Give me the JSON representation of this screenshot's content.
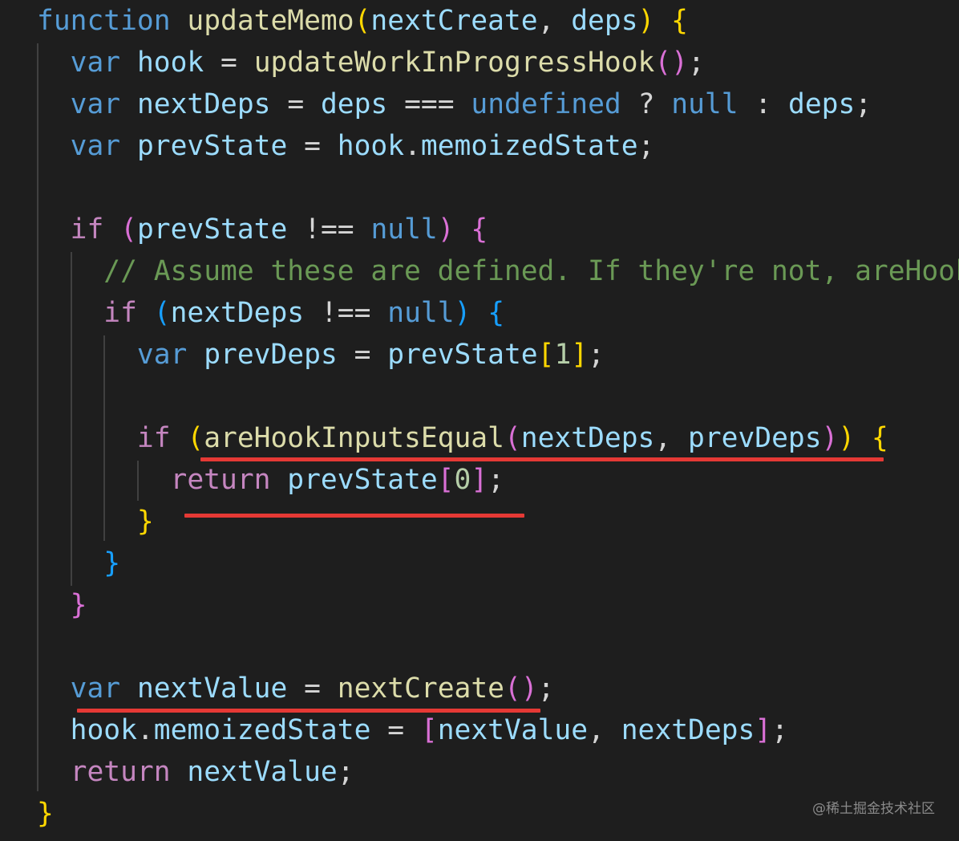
{
  "editor": {
    "language": "javascript",
    "lines": [
      "function updateMemo(nextCreate, deps) {",
      "  var hook = updateWorkInProgressHook();",
      "  var nextDeps = deps === undefined ? null : deps;",
      "  var prevState = hook.memoizedState;",
      "",
      "  if (prevState !== null) {",
      "    // Assume these are defined. If they're not, areHookInputsEqual will warn.",
      "    if (nextDeps !== null) {",
      "      var prevDeps = prevState[1];",
      "",
      "      if (areHookInputsEqual(nextDeps, prevDeps)) {",
      "        return prevState[0];",
      "      }",
      "    }",
      "  }",
      "",
      "  var nextValue = nextCreate();",
      "  hook.memoizedState = [nextValue, nextDeps];",
      "  return nextValue;",
      "}"
    ]
  },
  "colors": {
    "background": "#1e1e1e",
    "storage_keyword": "#569cd6",
    "control_keyword": "#c586c0",
    "function_name": "#dcdcaa",
    "variable": "#9cdcfe",
    "comment": "#6a9955",
    "number": "#b5cea8",
    "bracket_level_1": "#ffd700",
    "bracket_level_2": "#da70d6",
    "bracket_level_3": "#179fff",
    "annotation_underline": "#e53935"
  },
  "watermark": "@稀土掘金技术社区"
}
